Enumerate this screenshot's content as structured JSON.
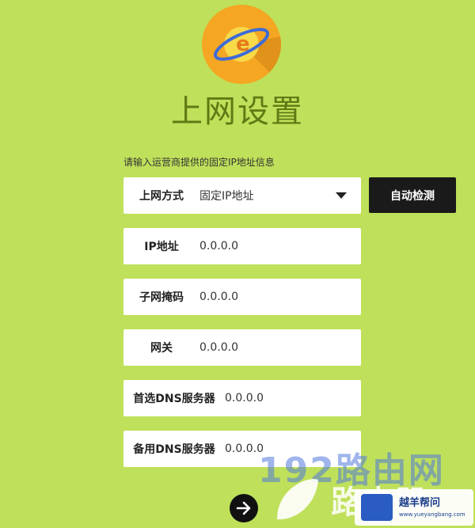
{
  "page": {
    "title": "上网设置",
    "hint": "请输入运营商提供的固定IP地址信息"
  },
  "form": {
    "mode": {
      "label": "上网方式",
      "value": "固定IP地址"
    },
    "ip": {
      "label": "IP地址",
      "value": "0.0.0.0"
    },
    "mask": {
      "label": "子网掩码",
      "value": "0.0.0.0"
    },
    "gateway": {
      "label": "网关",
      "value": "0.0.0.0"
    },
    "dns1": {
      "label": "首选DNS服务器",
      "value": "0.0.0.0"
    },
    "dns2": {
      "label": "备用DNS服务器",
      "value": "0.0.0.0"
    }
  },
  "buttons": {
    "detect": "自动检测",
    "next_icon": "arrow-right-icon"
  },
  "watermark": {
    "text1": "192路由网",
    "text2": "路由器",
    "badge_title": "越羊帮问",
    "badge_url": "www.yueyangbang.com"
  },
  "colors": {
    "background": "#bfe05a",
    "title": "#5f7a14",
    "logo": "#f5a623",
    "button": "#1a1a1a"
  }
}
